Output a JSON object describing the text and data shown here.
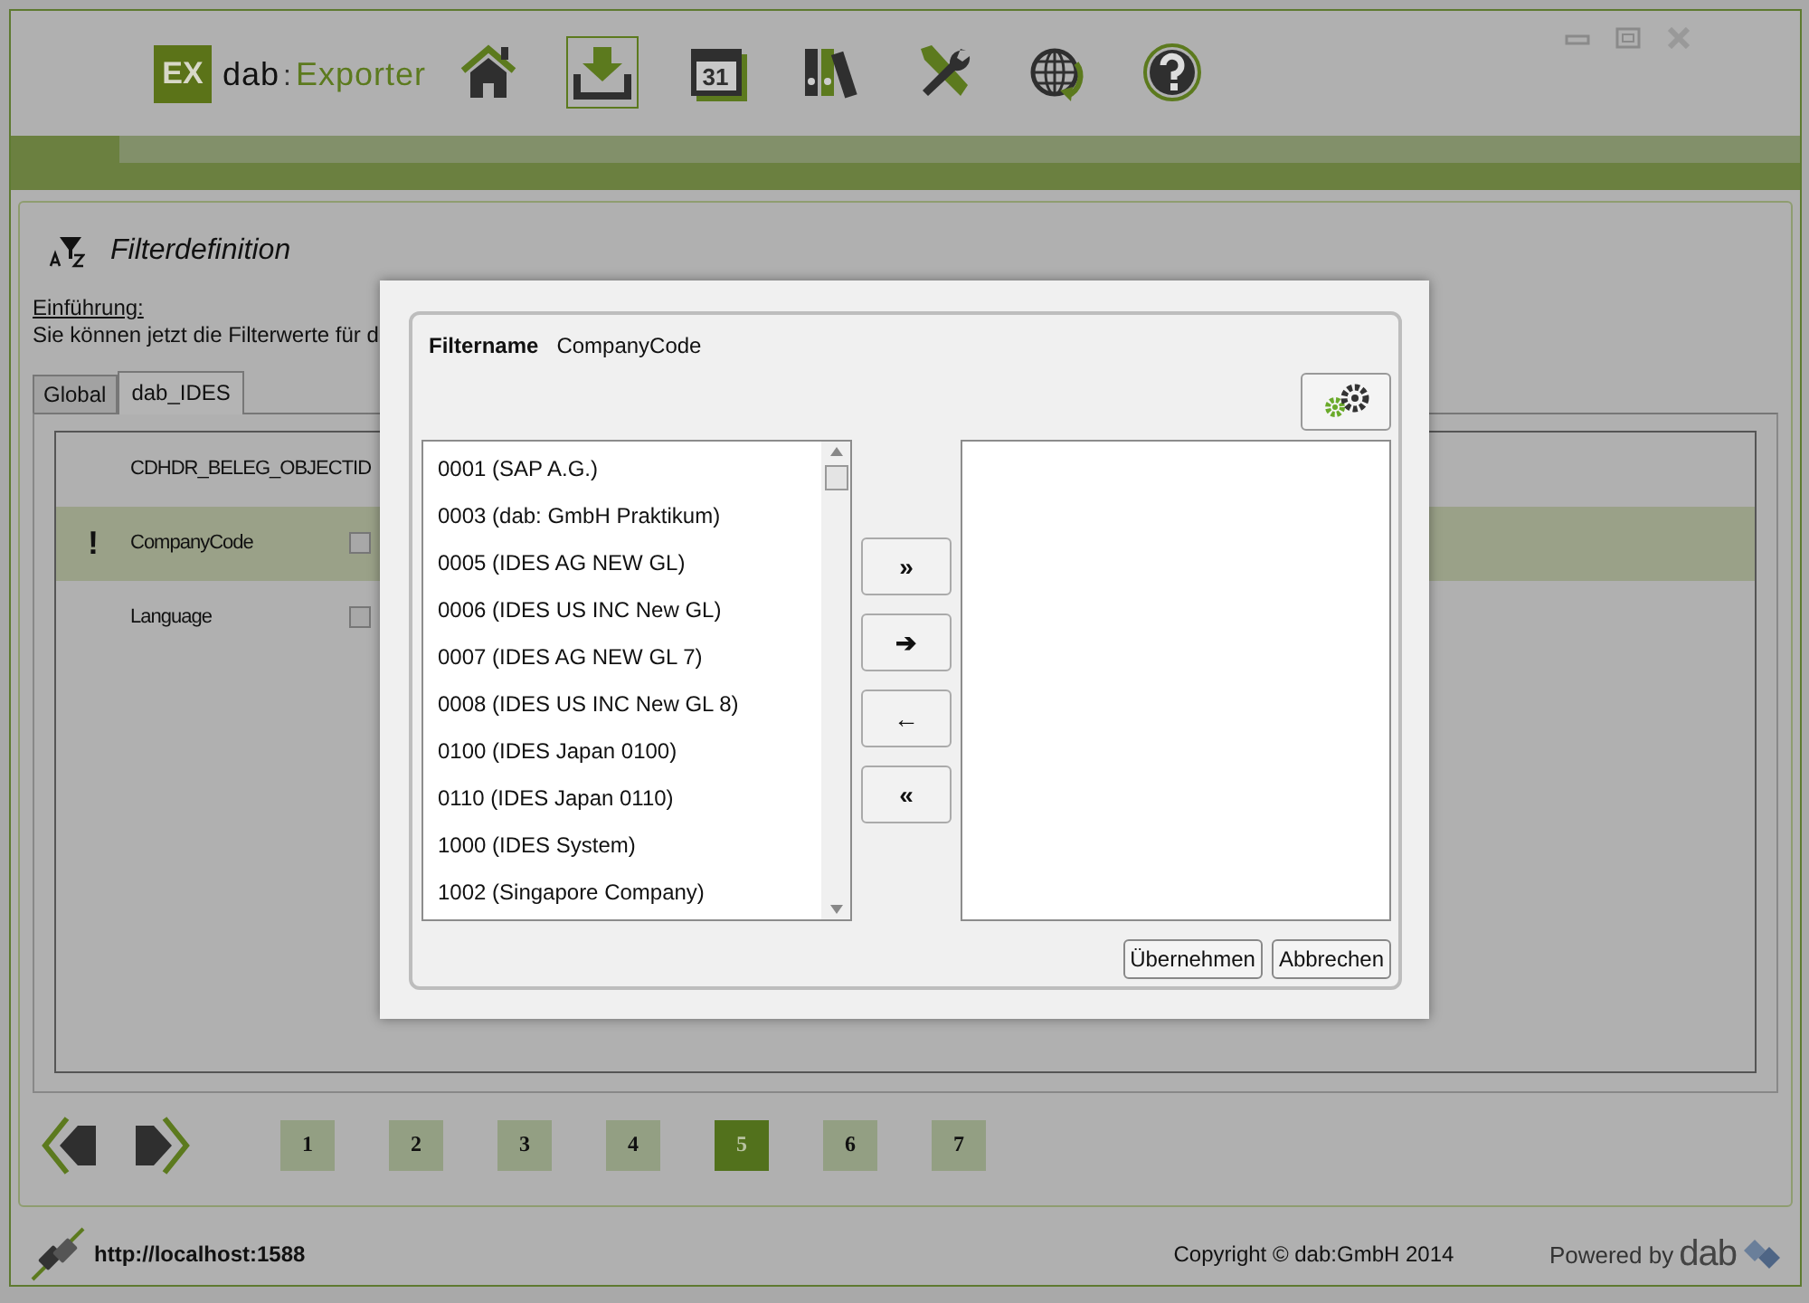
{
  "window": {
    "controls": [
      {
        "kind": "minimize"
      },
      {
        "kind": "maximize"
      },
      {
        "kind": "close"
      }
    ]
  },
  "header": {
    "logo": {
      "badge": "EX",
      "brand": "dab",
      "separator": ":",
      "product": "Exporter"
    },
    "nav": [
      {
        "kind": "home",
        "selected": false
      },
      {
        "kind": "download",
        "selected": true
      },
      {
        "kind": "calendar",
        "label": "31",
        "selected": false
      },
      {
        "kind": "binders",
        "selected": false
      },
      {
        "kind": "tools",
        "selected": false
      },
      {
        "kind": "globe",
        "selected": false
      },
      {
        "kind": "help",
        "selected": false
      }
    ]
  },
  "page": {
    "title": "Filterdefinition",
    "intro_heading": "Einführung:",
    "intro_text": "Sie können jetzt die Filterwerte für d",
    "tabs": [
      {
        "label": "Global",
        "selected": false
      },
      {
        "label": "dab_IDES",
        "selected": true
      }
    ],
    "filters": [
      {
        "name": "CDHDR_BELEG_OBJECTID",
        "selected": false
      },
      {
        "name": "CompanyCode",
        "mark": "!",
        "checked": false,
        "selected": true
      },
      {
        "name": "Language",
        "checked": false,
        "selected": false
      }
    ]
  },
  "pager": {
    "pages": [
      {
        "label": "1",
        "selected": false
      },
      {
        "label": "2",
        "selected": false
      },
      {
        "label": "3",
        "selected": false
      },
      {
        "label": "4",
        "selected": false
      },
      {
        "label": "5",
        "selected": true
      },
      {
        "label": "6",
        "selected": false
      },
      {
        "label": "7",
        "selected": false
      }
    ]
  },
  "status_bar": {
    "url": "http://localhost:1588",
    "copyright": "Copyright © dab:GmbH 2014",
    "powered_by": "Powered by",
    "powered_logo": "dab"
  },
  "dialog": {
    "field_label": "Filtername",
    "field_value": "CompanyCode",
    "available": [
      "0001 (SAP A.G.)",
      "0003 (dab: GmbH Praktikum)",
      "0005 (IDES AG NEW GL)",
      "0006 (IDES US INC New GL)",
      "0007 (IDES AG NEW GL 7)",
      "0008 (IDES US INC New GL 8)",
      "0100 (IDES Japan 0100)",
      "0110 (IDES Japan 0110)",
      "1000 (IDES System)",
      "1002 (Singapore Company)"
    ],
    "move_buttons": [
      "»",
      "➔",
      "←",
      "«"
    ],
    "buttons": [
      "Übernehmen",
      "Abbrechen"
    ]
  }
}
